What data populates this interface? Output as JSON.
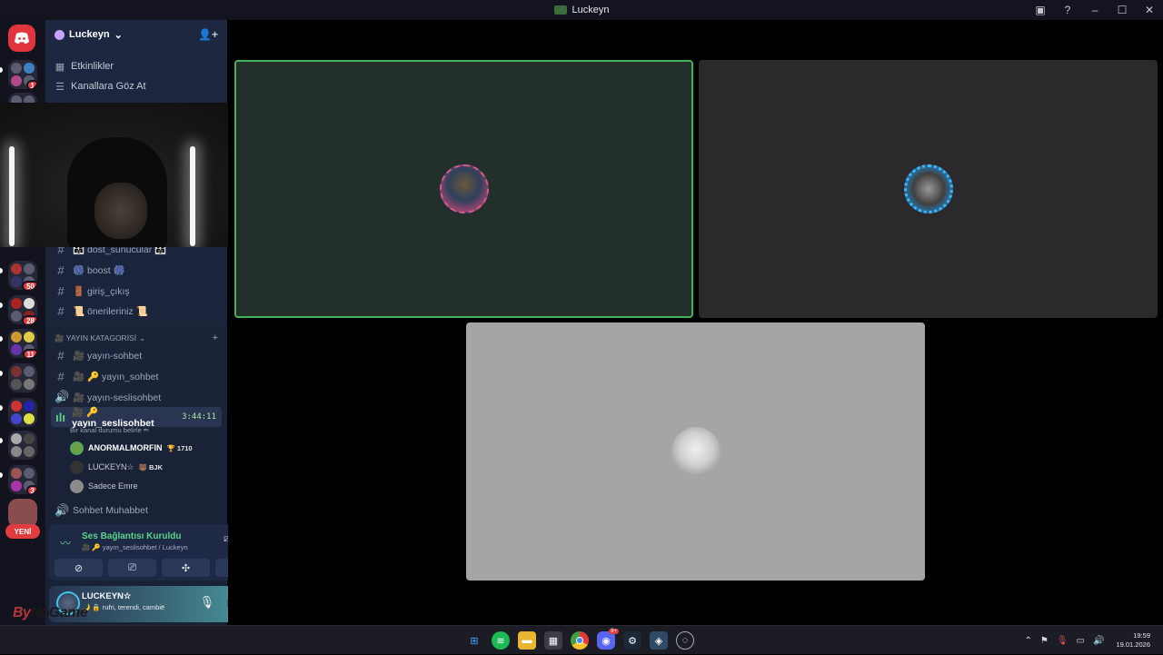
{
  "window": {
    "title": "Luckeyn"
  },
  "server": {
    "name": "Luckeyn"
  },
  "nav": [
    {
      "label": "Etkinlikler",
      "icon": "calendar-icon"
    },
    {
      "label": "Kanallara Göz At",
      "icon": "browse-channels-icon"
    }
  ],
  "text_channels": [
    {
      "label": "👨‍👩‍👧 dost_sunucular 👨‍👩‍👧"
    },
    {
      "label": "🎆 boost 🎆"
    },
    {
      "label": "🚪 giriş_çıkış"
    },
    {
      "label": "📜 önerileriniz 📜"
    }
  ],
  "category": {
    "label": "🎥 YAYIN KATAGORİSİ"
  },
  "stream_channels": [
    {
      "label": "🎥 yayın-sohbet",
      "type": "text"
    },
    {
      "label": "🎥 🔑 yayın_sohbet",
      "type": "text"
    },
    {
      "label": "🎥 yayın-seslisohbet",
      "type": "voice"
    }
  ],
  "active_voice": {
    "label": "🎥 🔑 yayın_seslisohbet",
    "timer": "3:44:11",
    "status_hint": "Bir kanal durumu belirle ✏"
  },
  "voice_users": [
    {
      "name": "ANORMALMORFIN",
      "tag": "🏆 1710"
    },
    {
      "name": "LUCKEYN☆",
      "tag": "🐻 BJK"
    },
    {
      "name": "Sadece Emre",
      "tag": ""
    }
  ],
  "extra_channel": {
    "label": "Sohbet Muhabbet"
  },
  "voice_panel": {
    "status": "Ses Bağlantısı Kuruldu",
    "channel": "🎥 🔑 yayın_seslisohbet / Luckeyn"
  },
  "user_panel": {
    "name": "LUCKEYN☆",
    "status": "🌙 🔒 rufri, terendi, cambië"
  },
  "rail": {
    "new_label": "YENİ",
    "badges": [
      "1",
      "50",
      "28",
      "11",
      "3"
    ]
  },
  "watermark": {
    "brand": "By",
    "rest": "NoGame"
  },
  "taskbar": {
    "time": "19:59",
    "date": "19.01.2026",
    "discord_badge": "9+"
  },
  "colors": {
    "speaking": "#46b05c",
    "tile1": "#222f2b",
    "tile2": "#2a2a2d",
    "tile3": "#a6a4a4",
    "voice_connected": "#5ad48a",
    "alert": "#e23c41"
  }
}
